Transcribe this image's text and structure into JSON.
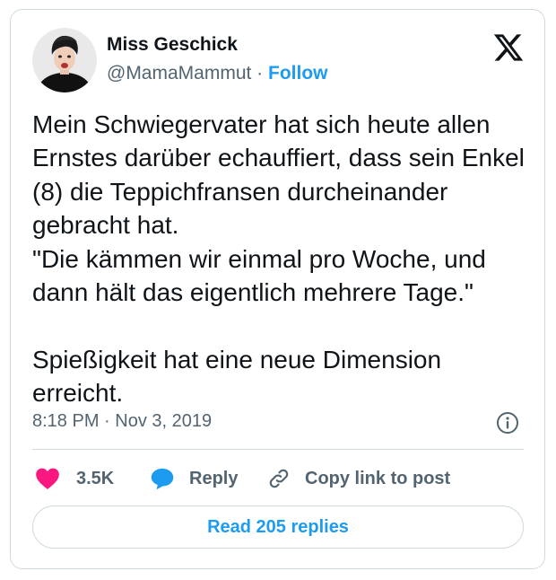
{
  "author": {
    "display_name": "Miss Geschick",
    "handle": "@MamaMammut",
    "separator": " · ",
    "follow_label": "Follow"
  },
  "tweet": {
    "text": "Mein Schwiegervater hat sich heute allen Ernstes darüber echauffiert, dass sein Enkel (8) die Teppichfransen durcheinander gebracht hat.\n\"Die kämmen wir einmal pro Woche, und dann hält das eigentlich mehrere Tage.\"\n\nSpießigkeit hat eine neue Dimension erreicht.",
    "timestamp": "8:18 PM · Nov 3, 2019"
  },
  "actions": {
    "like_count": "3.5K",
    "reply_label": "Reply",
    "copy_label": "Copy link to post"
  },
  "footer": {
    "read_replies_label": "Read 205 replies"
  },
  "icons": {
    "platform_logo": "x-logo",
    "info": "info-icon",
    "like": "heart-icon",
    "reply": "speech-bubble-icon",
    "copy": "link-icon"
  },
  "colors": {
    "accent": "#1d9bf0",
    "like": "#f91880",
    "text_primary": "#0f1419",
    "text_secondary": "#536471",
    "border": "#cfd9de"
  }
}
